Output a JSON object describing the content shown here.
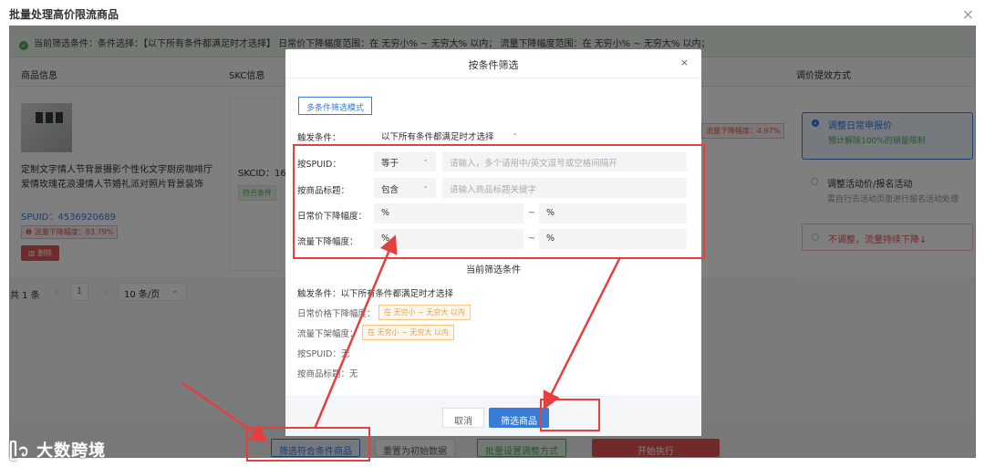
{
  "page": {
    "title": "批量处理高价限流商品",
    "close": "×"
  },
  "notice": {
    "text": "当前筛选条件：条件选择：【以下所有条件都满足时才选择】 日常价下降幅度范围：在 无穷小% ~ 无穷大% 以内； 流量下降幅度范围：在 无穷小% ~ 无穷大% 以内；"
  },
  "table": {
    "headers": {
      "product": "商品信息",
      "skc": "SKC信息",
      "adjust": "调价提效方式"
    },
    "row": {
      "title": "定制文字情人节背景摄影个性化文字厨房咖啡厅爱情玫瑰花浪漫情人节婚礼派对照片背景装饰",
      "spuid": "SPUID：4536920689",
      "flow_badge": "流量下降幅度：83.79%",
      "delete": "删除",
      "skcid": "SKCID：16",
      "skc_tag": "符合条件",
      "right_badge": "流量下降幅度：4.97%"
    },
    "adjust": {
      "opt1_title": "调整日常申报价",
      "opt1_desc": "预计解除100%的销量限制",
      "opt2_title": "调整活动价/报名活动",
      "opt2_desc": "需自行去活动页面进行报名活动处理",
      "opt3_title": "不调整，流量持续下降↓"
    }
  },
  "pager": {
    "total": "共 1 条",
    "prev": "‹",
    "page": "1",
    "next": "›",
    "size": "10 条/页",
    "size_chev": "⌄"
  },
  "footer": {
    "filter_btn": "筛选符合条件商品",
    "reset_btn": "重置为初始数据",
    "batch_btn": "批量设置调整方式",
    "execute_btn": "开始执行"
  },
  "watermark": "大数跨境",
  "modal": {
    "title": "按条件筛选",
    "close": "×",
    "tab": "多条件筛选模式",
    "trigger_label": "触发条件：",
    "trigger_value": "以下所有条件都满足时才选择",
    "spuid_label": "按SPUID：",
    "spuid_op": "等于",
    "spuid_placeholder": "请输入，多个请用中/英文逗号或空格间隔开",
    "title_label": "按商品标题：",
    "title_op": "包含",
    "title_placeholder": "请输入商品标题关键字",
    "price_label": "日常价下降幅度：",
    "flow_label": "流量下降幅度：",
    "percent": "%",
    "tilde": "~",
    "chev": "⌄",
    "current_title": "当前筛选条件",
    "sum_trigger": "触发条件：以下所有条件都满足时才选择",
    "sum_price_label": "日常价格下降幅度：",
    "sum_price_tag": "在 无穷小 ~ 无穷大 以内",
    "sum_flow_label": "流量下架幅度：",
    "sum_flow_tag": "在 无穷小 ~ 无穷大 以内",
    "sum_spuid": "按SPUID：无",
    "sum_title": "按商品标题：无",
    "cancel": "取消",
    "confirm": "筛选商品"
  },
  "colors": {
    "primary": "#3a7bd5",
    "danger": "#e53f3f",
    "success": "#52a65e",
    "warning": "#e6a23c"
  }
}
